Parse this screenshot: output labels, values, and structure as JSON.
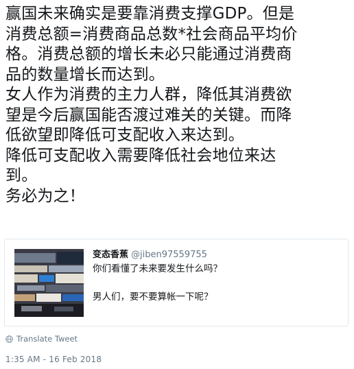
{
  "tweet": {
    "lines": [
      "赢国未来确实是要靠消费支撑GDP。但是",
      "消费总额=消费商品总数*社会商品平均价",
      "格。消费总额的增长未必只能通过消费商",
      "品的数量增长而达到。",
      "女人作为消费的主力人群，降低其消费欲",
      "望是今后赢国能否渡过难关的关键。而降",
      "低欲望即降低可支配收入来达到。",
      "降低可支配收入需要降低社会地位来达",
      "到。",
      "务必为之！"
    ]
  },
  "quoted_tweet": {
    "display_name": "变态香蕉",
    "handle": "@jiben97559755",
    "line1": "你们看懂了未来要发生什么吗？",
    "line2": "男人们，要不要算帐一下呢？"
  },
  "translate_label": "Translate Tweet",
  "timestamp": "1:35 AM - 16 Feb 2018",
  "icons": {
    "translate": "globe-icon"
  },
  "colors": {
    "text": "#14171a",
    "muted": "#657786",
    "border": "#e1e8ed"
  }
}
